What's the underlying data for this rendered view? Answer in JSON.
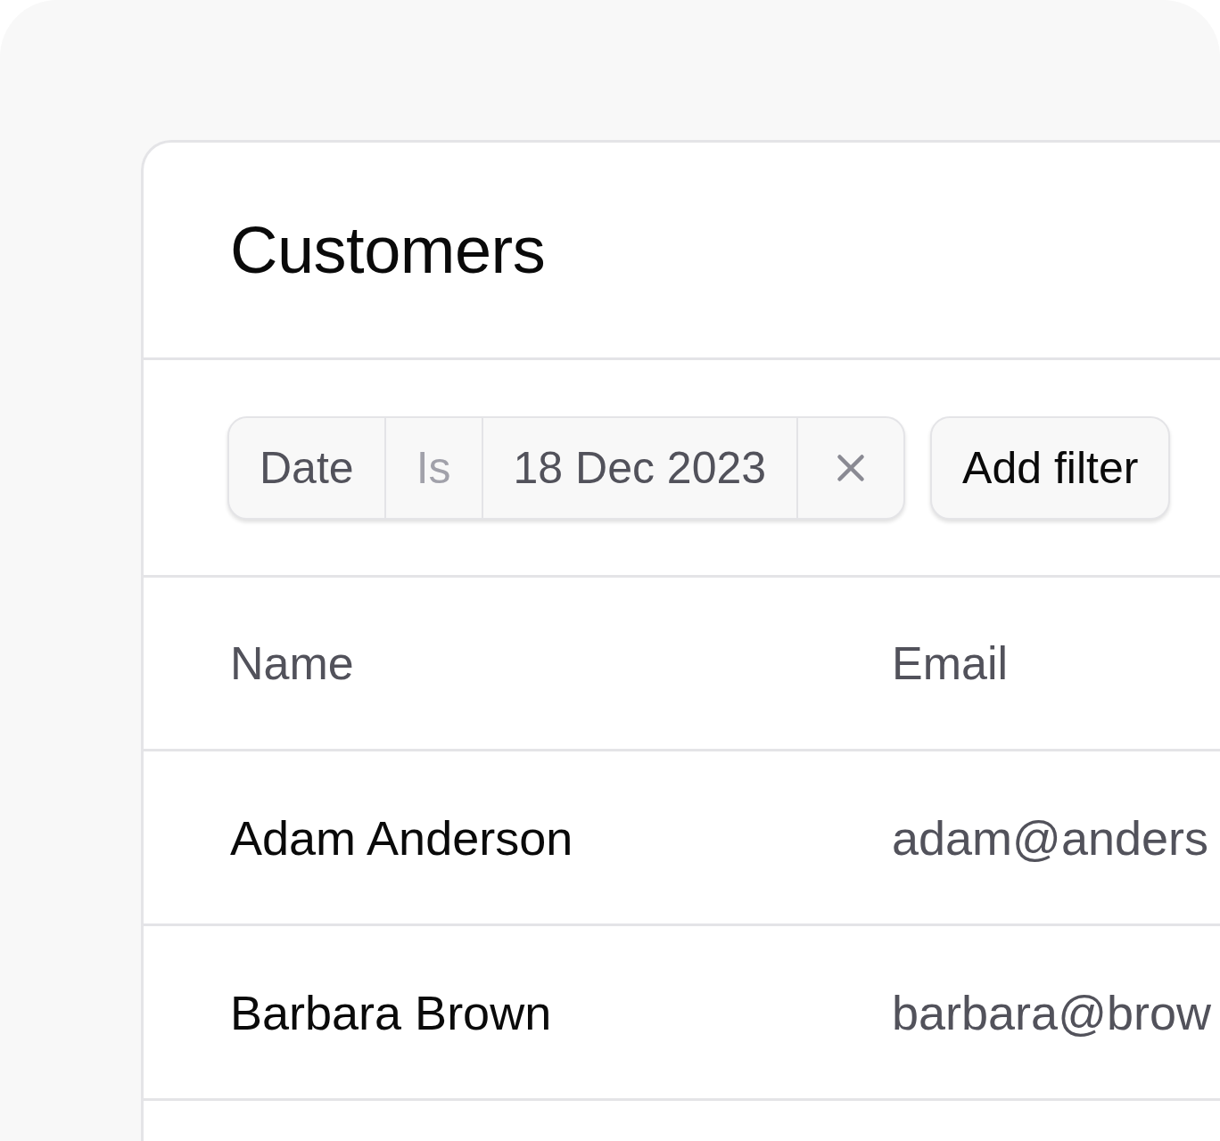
{
  "title": "Customers",
  "filter": {
    "field": "Date",
    "operator": "Is",
    "value": "18 Dec 2023"
  },
  "add_filter": {
    "label": "Add filter"
  },
  "table": {
    "columns": [
      "Name",
      "Email"
    ],
    "rows": [
      [
        "Adam Anderson",
        "adam@anders"
      ],
      [
        "Barbara Brown",
        "barbara@brow"
      ]
    ]
  }
}
